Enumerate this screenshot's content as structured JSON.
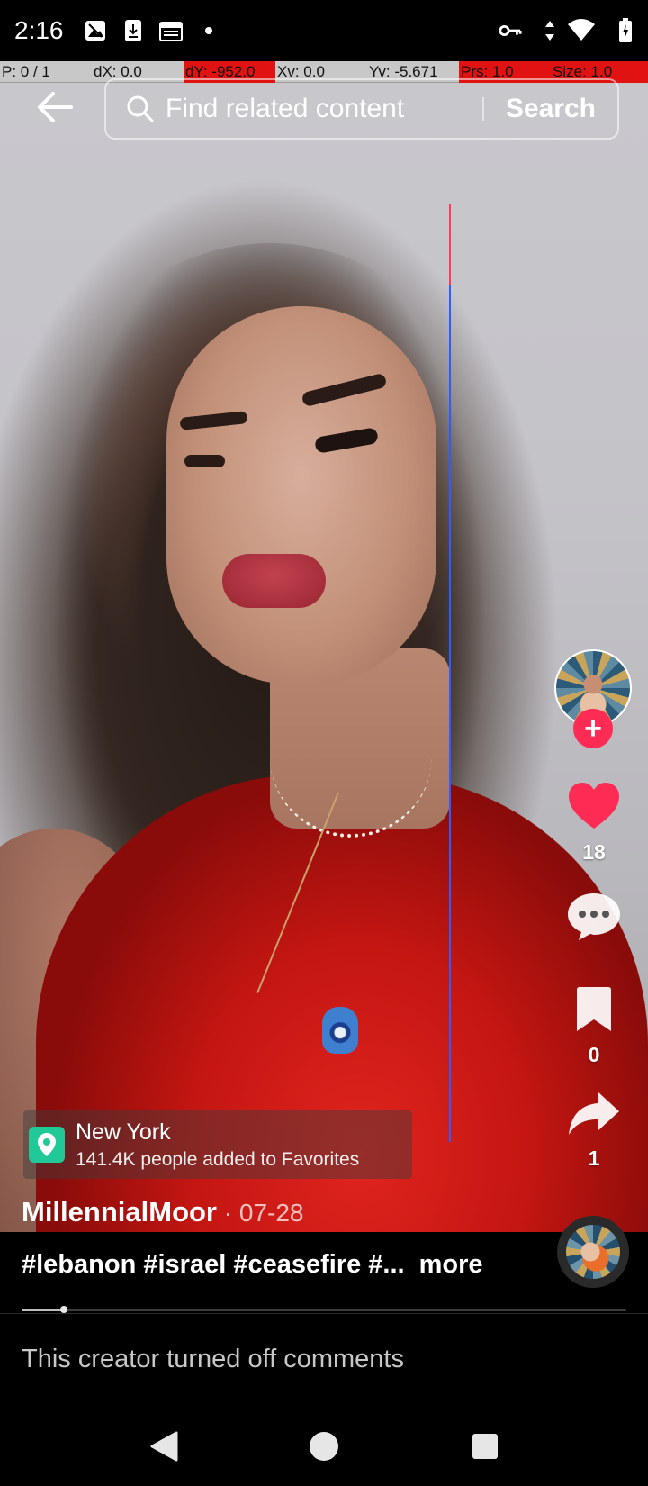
{
  "status_bar": {
    "time": "2:16",
    "left_icons": [
      "photo-icon",
      "download-icon",
      "calendar-icon",
      "dot-icon"
    ],
    "right_icons": [
      "vpn-key-icon",
      "data-arrows-icon",
      "wifi-icon",
      "battery-charging-icon"
    ]
  },
  "debug_overlay": {
    "fields": [
      {
        "text": "P: 0 / 1",
        "highlight": false
      },
      {
        "text": "dX: 0.0",
        "highlight": false
      },
      {
        "text": "dY: -952.0",
        "highlight": true
      },
      {
        "text": "Xv: 0.0",
        "highlight": false
      },
      {
        "text": "Yv: -5.671",
        "highlight": false
      },
      {
        "text": "Prs: 1.0",
        "highlight": true
      },
      {
        "text": "Size: 1.0",
        "highlight": true
      }
    ]
  },
  "header": {
    "back_icon": "arrow-left-icon",
    "search_placeholder": "Find related content",
    "search_button": "Search"
  },
  "rail": {
    "likes": "18",
    "saves": "0",
    "shares": "1",
    "follow_label": "+"
  },
  "location": {
    "name": "New York",
    "subtitle": "141.4K people added to Favorites"
  },
  "post": {
    "creator": "MillennialMoor",
    "date": " · 07-28",
    "caption": "#lebanon #israel #ceasefire #...",
    "more_label": "more",
    "progress": 0.07
  },
  "comments": {
    "notice": "This creator turned off comments"
  },
  "colors": {
    "accent_red": "#fe2c55",
    "location_green": "#20c997"
  }
}
